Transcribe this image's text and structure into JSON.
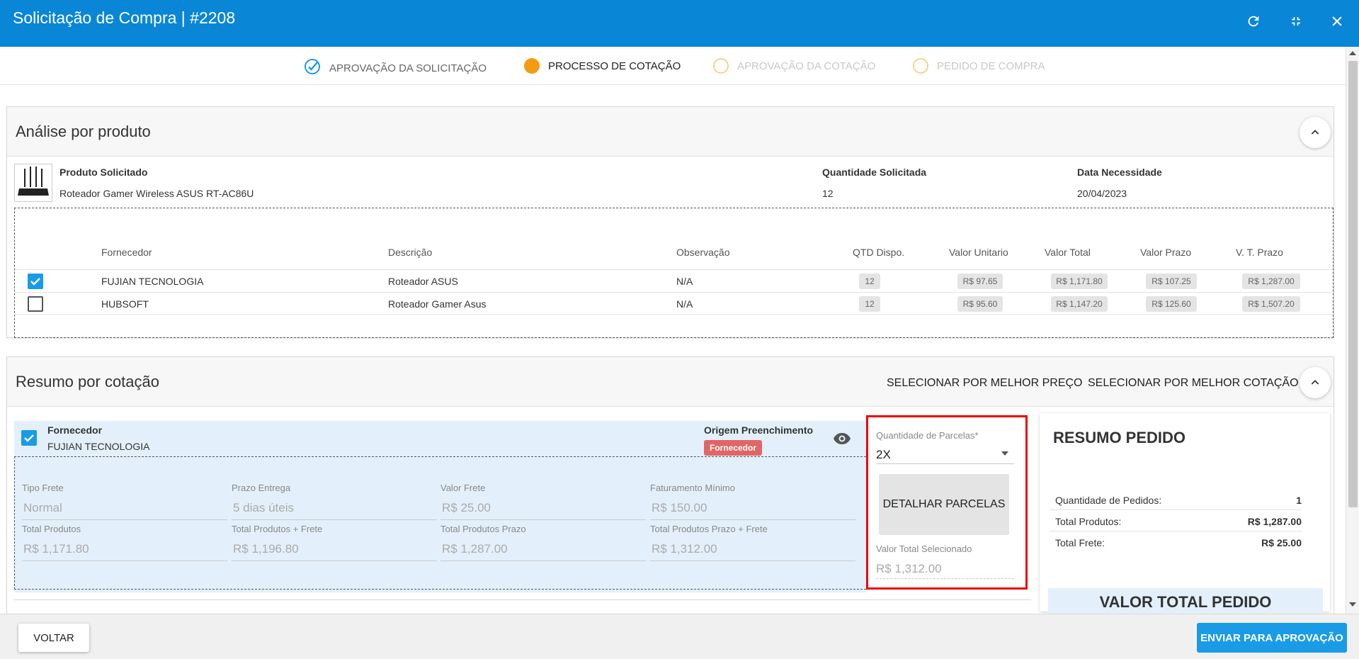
{
  "header": {
    "title": "Solicitação de Compra | #2208",
    "icons": [
      "refresh-icon",
      "collapse-icon",
      "close-icon"
    ]
  },
  "stepper": [
    {
      "label": "APROVAÇÃO DA SOLICITAÇÃO",
      "state": "done"
    },
    {
      "label": "PROCESSO DE COTAÇÃO",
      "state": "active"
    },
    {
      "label": "APROVAÇÃO DA COTAÇÃO",
      "state": "pending"
    },
    {
      "label": "PEDIDO DE COMPRA",
      "state": "pending"
    }
  ],
  "analise": {
    "title": "Análise por produto",
    "produto_label": "Produto Solicitado",
    "produto_value": "Roteador Gamer Wireless ASUS RT-AC86U",
    "qtd_label": "Quantidade Solicitada",
    "qtd_value": "12",
    "data_label": "Data Necessidade",
    "data_value": "20/04/2023",
    "columns": [
      "Fornecedor",
      "Descrição",
      "Observação",
      "QTD Dispo.",
      "Valor Unitario",
      "Valor Total",
      "Valor Prazo",
      "V. T. Prazo"
    ],
    "rows": [
      {
        "checked": true,
        "fornecedor": "FUJIAN TECNOLOGIA",
        "descricao": "Roteador ASUS",
        "observacao": "N/A",
        "qtd": "12",
        "unit": "R$ 97.65",
        "total": "R$ 1,171.80",
        "prazo": "R$ 107.25",
        "tprazo": "R$ 1,287.00"
      },
      {
        "checked": false,
        "fornecedor": "HUBSOFT",
        "descricao": "Roteador Gamer Asus",
        "observacao": "N/A",
        "qtd": "12",
        "unit": "R$ 95.60",
        "total": "R$ 1,147.20",
        "prazo": "R$ 125.60",
        "tprazo": "R$ 1,507.20"
      }
    ]
  },
  "resumo_cotacao": {
    "title": "Resumo por cotação",
    "melhor_preco": "SELECIONAR POR MELHOR PREÇO",
    "melhor_cotacao": "SELECIONAR POR MELHOR COTAÇÃO",
    "fornecedor_label": "Fornecedor",
    "fornecedor_value": "FUJIAN TECNOLOGIA",
    "origem_label": "Origem Preenchimento",
    "origem_badge": "Fornecedor",
    "fields": {
      "tipo_frete": {
        "label": "Tipo Frete",
        "value": "Normal"
      },
      "prazo_entrega": {
        "label": "Prazo Entrega",
        "value": "5 dias úteis"
      },
      "valor_frete": {
        "label": "Valor Frete",
        "value": "R$ 25.00"
      },
      "fat_minimo": {
        "label": "Faturamento Mínimo",
        "value": "R$ 150.00"
      },
      "total_produtos": {
        "label": "Total Produtos",
        "value": "R$ 1,171.80"
      },
      "total_frete": {
        "label": "Total Produtos + Frete",
        "value": "R$ 1,196.80"
      },
      "total_prazo": {
        "label": "Total Produtos Prazo",
        "value": "R$ 1,287.00"
      },
      "total_prazo_frete": {
        "label": "Total Produtos Prazo + Frete",
        "value": "R$ 1,312.00"
      }
    },
    "parcelas_label": "Quantidade de Parcelas",
    "parcelas_required": "*",
    "parcelas_value": "2X",
    "detalhar_label": "DETALHAR PARCELAS",
    "valor_sel_label": "Valor Total Selecionado",
    "valor_sel_value": "R$ 1,312.00"
  },
  "resumo_pedido": {
    "title": "RESUMO PEDIDO",
    "rows": [
      {
        "k": "Quantidade de Pedidos:",
        "v": "1"
      },
      {
        "k": "Total Produtos:",
        "v": "R$ 1,287.00"
      },
      {
        "k": "Total Frete:",
        "v": "R$ 25.00"
      }
    ],
    "valor_total_label": "VALOR TOTAL PEDIDO"
  },
  "footer": {
    "voltar": "VOLTAR",
    "enviar": "ENVIAR PARA APROVAÇÃO"
  },
  "colors": {
    "primary": "#0a86d6",
    "accent": "#1a9be6",
    "step_active": "#f39c12",
    "step_pending": "#f8d28a",
    "badge": "#e06666",
    "highlight": "#ee0000"
  }
}
